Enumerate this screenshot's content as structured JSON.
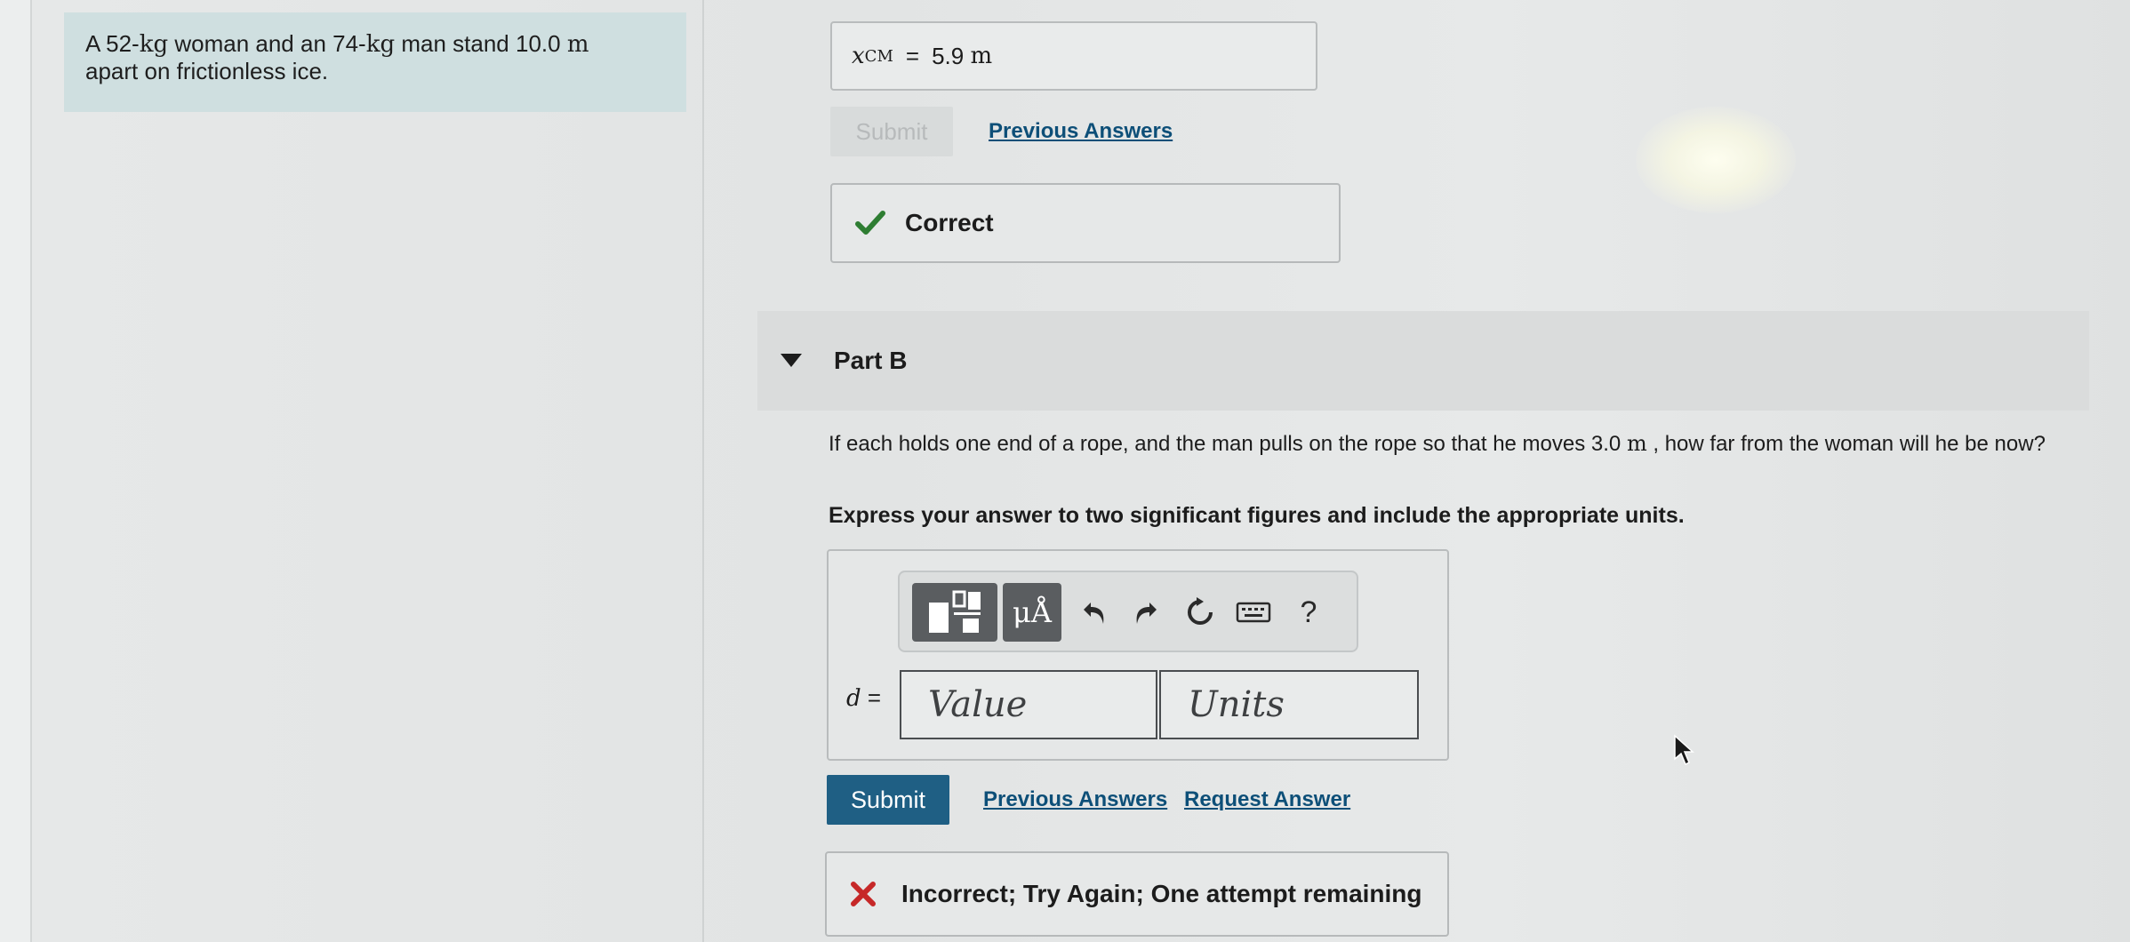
{
  "problem": {
    "text_a": "A 52-",
    "unit_kg_1": "kg",
    "text_b": " woman and an 74-",
    "unit_kg_2": "kg",
    "text_c": " man stand 10.0 ",
    "unit_m": "m",
    "text_d": "apart on frictionless ice."
  },
  "part_a": {
    "answer_var": "x",
    "answer_sub": "CM",
    "answer_eq": "=",
    "answer_value": "5.9",
    "answer_unit": "m",
    "submit_label": "Submit",
    "previous_answers_label": "Previous Answers",
    "feedback": "Correct",
    "feedback_color": "#2e7d32"
  },
  "part_b": {
    "title": "Part B",
    "question_a": "If each holds one end of a rope, and the man pulls on the rope so that he moves 3.0 ",
    "question_unit": "m",
    "question_b": " , how far from the woman will he be now?",
    "instruction": "Express your answer to two significant figures and include the appropriate units.",
    "toolbar": {
      "units_btn_label": "μÅ",
      "help_label": "?"
    },
    "var_label": "d",
    "eq": " =",
    "value_placeholder": "Value",
    "units_placeholder": "Units",
    "submit_label": "Submit",
    "previous_answers_label": "Previous Answers",
    "request_answer_label": "Request Answer",
    "feedback": "Incorrect; Try Again; One attempt remaining",
    "feedback_color": "#c62828",
    "submit_color": "#1f5f84"
  }
}
